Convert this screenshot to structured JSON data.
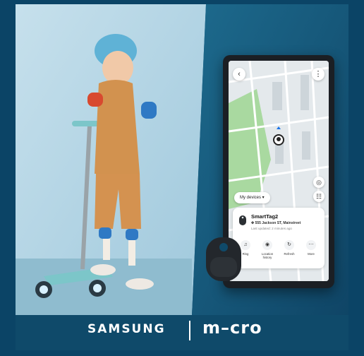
{
  "brand": {
    "samsung": "SAMSUNG",
    "micro": "m–cro"
  },
  "app": {
    "my_devices_label": "My devices ▾",
    "device": {
      "name": "SmartTag2",
      "address": "✤ 555 Jackson ST, Mainstreet",
      "updated": "Last updated: 2 minutes ago"
    },
    "actions": [
      {
        "label": "Ring",
        "icon": "ring-icon"
      },
      {
        "label": "Location history",
        "icon": "location-history-icon"
      },
      {
        "label": "Refresh",
        "icon": "refresh-icon"
      },
      {
        "label": "More",
        "icon": "more-icon"
      }
    ]
  },
  "colors": {
    "background": "#0b4466",
    "map_park": "#a9d9a0",
    "accent": "#1a73e8"
  }
}
